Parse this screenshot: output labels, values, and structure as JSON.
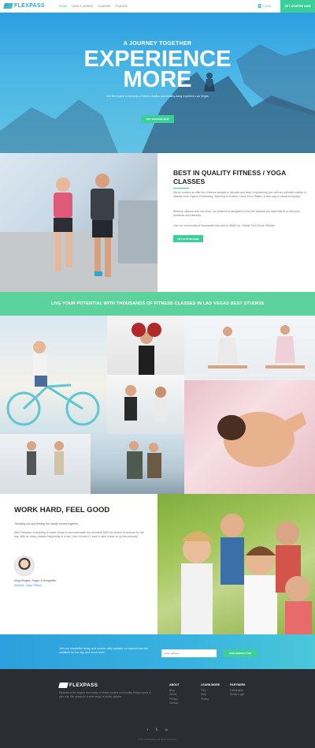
{
  "brand": {
    "name": "FLEXPASS",
    "logo_icon": "flexpass-logo-mark"
  },
  "nav": {
    "links": [
      {
        "label": "HOME",
        "active": true
      },
      {
        "label": "HOW IT WORKS",
        "active": false
      },
      {
        "label": "CLASSES",
        "active": false
      },
      {
        "label": "STUDIOS",
        "active": false
      }
    ],
    "login_label": "LOGIN",
    "cta_label": "GET STARTED NOW"
  },
  "hero": {
    "kicker": "A JOURNEY TOGETHER",
    "title_line1": "EXPERIENCE",
    "title_line2": "MORE",
    "subtitle": "Join the largest community of fitness studios and healthy-living experts in Las Vegas.",
    "button_label": "GET STARTED NOW"
  },
  "quality": {
    "title": "BEST IN QUALITY FITNESS / YOGA CLASSES",
    "paragraphs": [
      "We've curated an elite list of fitness classes in Nevada and Asia. Empowering you with an unlimited variety of classes from Yoga to Kickboxing, Spinning to Zumba, Cross Fit to Pilates. A new way to sweat everyday!",
      "Reserve classes with one click. Our platform is designed to find the classes you want that fit in with your schedule and interests.",
      "Join our community of thousands who love to Wake Up, Sweat, Feel Good, Repeat."
    ],
    "button_label": "GET STARTED NOW"
  },
  "banner": {
    "text": "LIVE YOUR POTENTIAL WITH THOUSANDS OF FITNESS CLASSES IN LAS VEGAS BEST STUDIOS"
  },
  "testimonial": {
    "title": "WORK HARD, FEEL GOOD",
    "quote": "\"Working out and feeling fun hardly comes together.",
    "body": "With Flexpass, everything is made simple to accommodate my schedule AND my choice of workout for the day. With so many classes happening in a day I can choose if I want to take it slow or up the intensity.\"",
    "author": "Ming Bridges, Singer & Songwriter",
    "tags": "Weights, Yoga, Pilates"
  },
  "newsletter": {
    "text": "Join our newsletter today and receive daily updates on classes that are available for the day and much more.",
    "placeholder": "Enter address",
    "button_label": "JOIN NEWSLETTER"
  },
  "footer": {
    "description": "Flexpass is the largest community of fitness studios and healthy living experts in your city. Get access to a wide range of studio classes.",
    "columns": [
      {
        "heading": "ABOUT",
        "items": [
          "Blog",
          "Terms",
          "Privacy",
          "Contact"
        ]
      },
      {
        "heading": "LEARN MORE",
        "items": [
          "FAQ",
          "Help",
          "Pricing"
        ]
      },
      {
        "heading": "PARTNERS",
        "items": [
          "Partnership",
          "Studio Login"
        ]
      }
    ],
    "social_icons": [
      "facebook-icon",
      "twitter-icon",
      "instagram-icon"
    ],
    "copyright": "2017 © Flexpass. All rights reserved."
  },
  "colors": {
    "accent_green": "#3dcf9b",
    "brand_blue": "#2c9fd8",
    "footer_bg": "#2a2d33"
  }
}
